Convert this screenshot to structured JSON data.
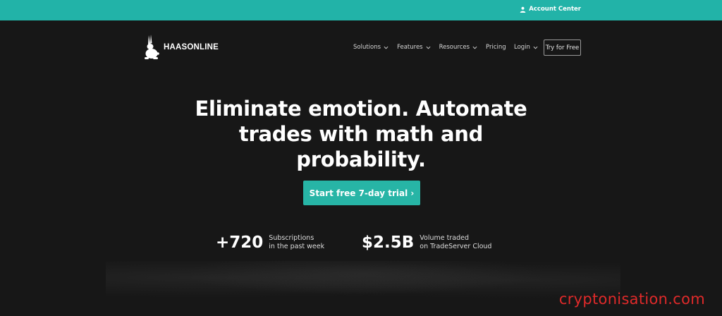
{
  "topbar": {
    "account_label": "Account Center",
    "account_icon": "user-icon",
    "bg_color": "#22b3a8"
  },
  "nav": {
    "brand": "HAASONLINE",
    "brand_icon": "rabbit-logo-icon",
    "items": [
      {
        "label": "Solutions",
        "has_dropdown": true
      },
      {
        "label": "Features",
        "has_dropdown": true
      },
      {
        "label": "Resources",
        "has_dropdown": true
      },
      {
        "label": "Pricing",
        "has_dropdown": false
      }
    ],
    "login_label": "Login",
    "try_label": "Try for Free"
  },
  "hero": {
    "headline": "Eliminate emotion. Automate trades with math and probability.",
    "cta_label": "Start free 7-day trial ›",
    "cta_color": "#27b5a6"
  },
  "stats": [
    {
      "value": "+720",
      "label_line1": "Subscriptions",
      "label_line2": "in the past week"
    },
    {
      "value": "$2.5B",
      "label_line1": "Volume traded",
      "label_line2": "on TradeServer Cloud"
    }
  ],
  "watermark": "cryptonisation.com"
}
